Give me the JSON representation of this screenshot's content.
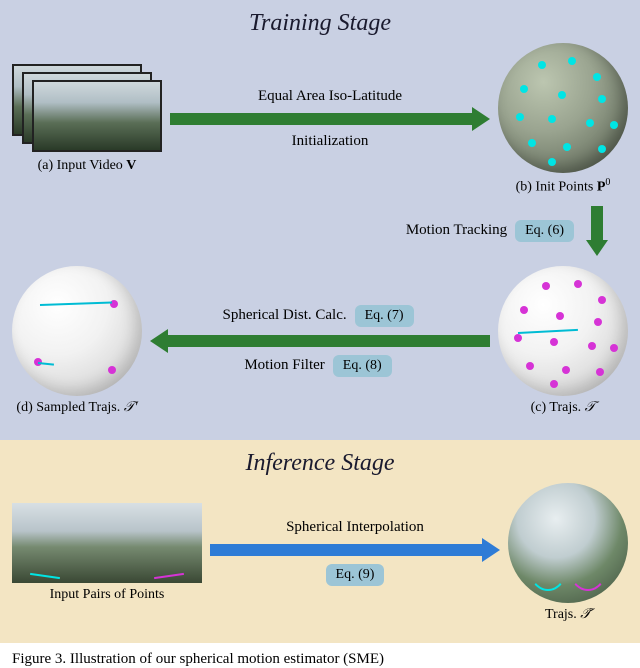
{
  "training": {
    "title": "Training Stage",
    "input_video": {
      "caption_prefix": "(a) Input Video ",
      "symbol": "V"
    },
    "arrow_init": {
      "line1": "Equal Area Iso-Latitude",
      "line2": "Initialization"
    },
    "init_points": {
      "caption_prefix": "(b) Init Points ",
      "symbol": "P",
      "sup": "0"
    },
    "arrow_track": {
      "line1": "Motion Tracking",
      "eq": "Eq. (6)"
    },
    "trajs": {
      "caption_prefix": "(c) Trajs. ",
      "symbol": "𝒯"
    },
    "arrow_filter": {
      "line1": "Spherical Dist. Calc.",
      "eq1": "Eq. (7)",
      "line2": "Motion Filter",
      "eq2": "Eq. (8)"
    },
    "sampled": {
      "caption_prefix": "(d) Sampled Trajs. ",
      "symbol": "𝒯′"
    }
  },
  "inference": {
    "title": "Inference Stage",
    "input": "Input Pairs of Points",
    "arrow": {
      "line1": "Spherical Interpolation",
      "eq": "Eq. (9)"
    },
    "output": {
      "caption_prefix": "Trajs. ",
      "symbol": "𝒯̃"
    }
  },
  "figure_caption": "Figure 3. Illustration of our spherical motion estimator (SME)"
}
